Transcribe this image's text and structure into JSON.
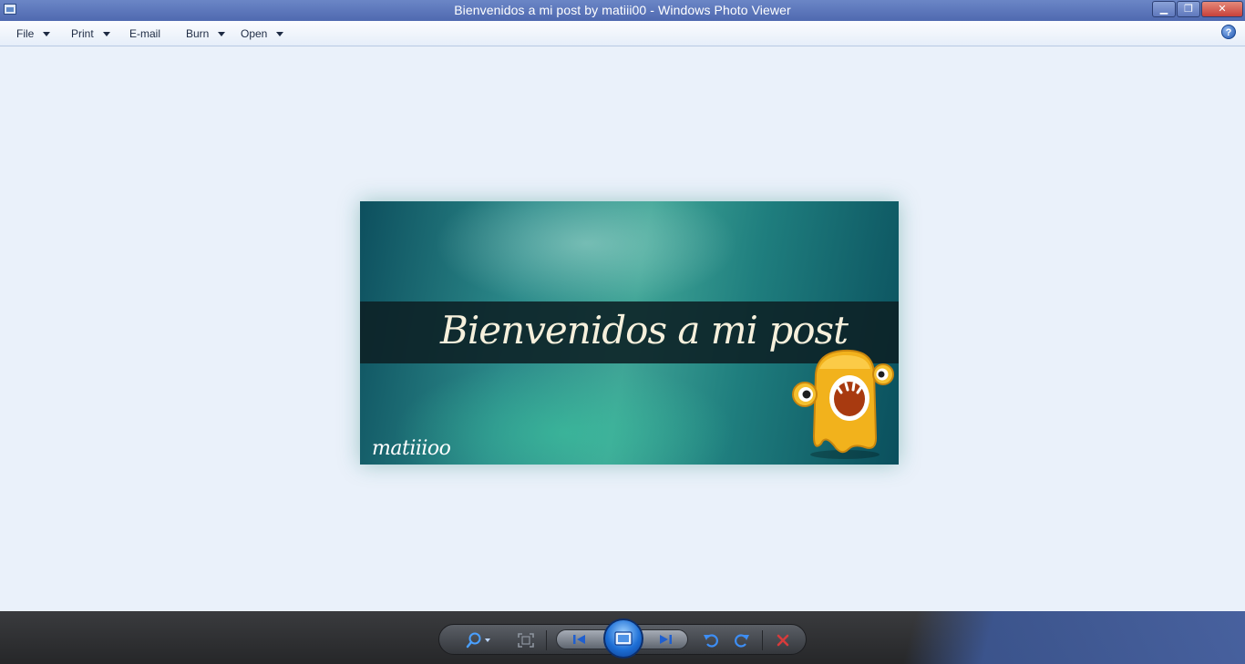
{
  "window": {
    "title": "Bienvenidos a mi post by matiii00 - Windows Photo Viewer",
    "minimize_label": "▁",
    "maximize_label": "❐",
    "close_label": "✕"
  },
  "menu": {
    "items": [
      {
        "label": "File",
        "has_dropdown": true
      },
      {
        "label": "Print",
        "has_dropdown": true
      },
      {
        "label": "E-mail",
        "has_dropdown": false
      },
      {
        "label": "Burn",
        "has_dropdown": true
      },
      {
        "label": "Open",
        "has_dropdown": true
      }
    ],
    "help_label": "?"
  },
  "photo": {
    "headline": "Bienvenidos a mi post",
    "signature": "matiiioo"
  },
  "toolbar": {
    "buttons": [
      {
        "name": "zoom-button",
        "icon": "magnifier-icon"
      },
      {
        "name": "actual-size-button",
        "icon": "fit-window-icon"
      },
      {
        "name": "previous-button",
        "icon": "previous-icon"
      },
      {
        "name": "slideshow-button",
        "icon": "slideshow-icon"
      },
      {
        "name": "next-button",
        "icon": "next-icon"
      },
      {
        "name": "rotate-counterclockwise-button",
        "icon": "rotate-ccw-icon"
      },
      {
        "name": "rotate-clockwise-button",
        "icon": "rotate-cw-icon"
      },
      {
        "name": "delete-button",
        "icon": "delete-icon"
      }
    ]
  },
  "colors": {
    "titlebar": "#5a74b8",
    "background": "#eaf1fa",
    "bottombar": "#2f3033",
    "delete_red": "#d63b3b"
  }
}
